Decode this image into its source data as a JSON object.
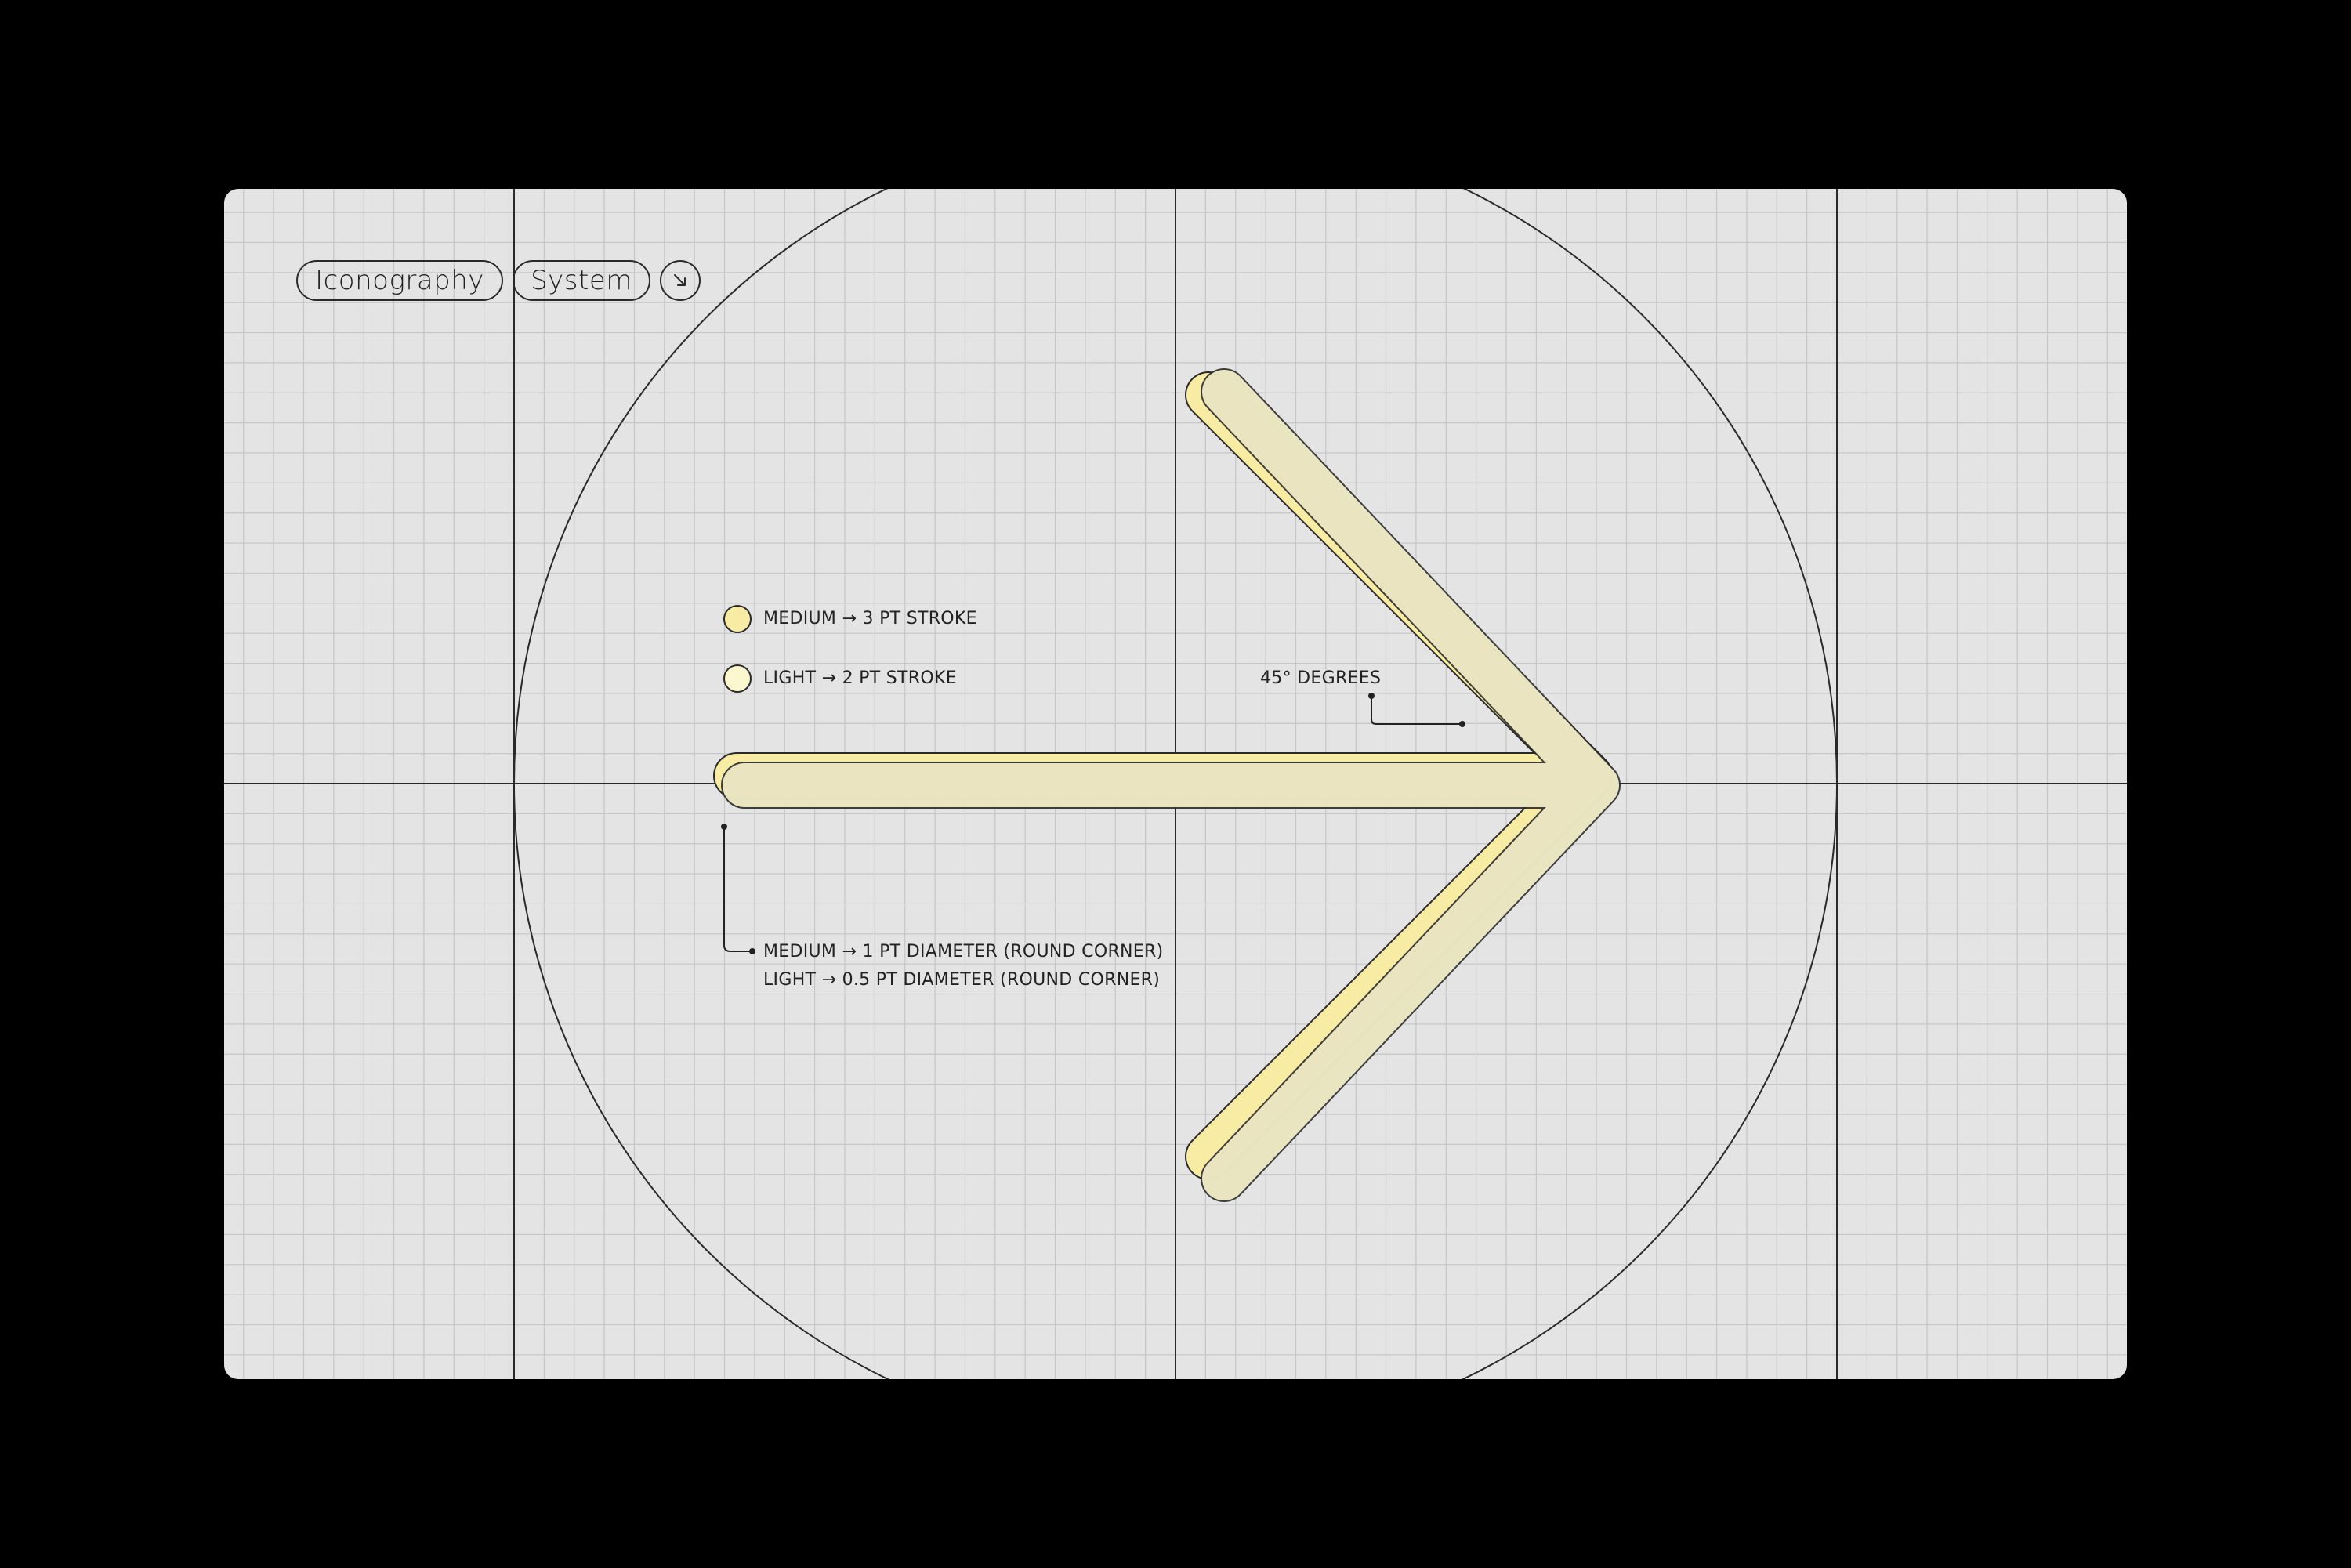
{
  "header": {
    "pill_1": "Iconography",
    "pill_2": "System",
    "arrow_button_icon": "arrow-down-right-icon"
  },
  "legend": {
    "medium_label": "MEDIUM → 3 PT STROKE",
    "light_label": "LIGHT → 2 PT STROKE",
    "medium_color": "#f8eba3",
    "light_color": "#fdf7cf"
  },
  "annotations": {
    "angle": "45° DEGREES",
    "corner_medium": "MEDIUM → 1 PT DIAMETER (ROUND CORNER)",
    "corner_light": "LIGHT → 0.5 PT DIAMETER (ROUND CORNER)"
  },
  "colors": {
    "background": "#000000",
    "panel": "#e4e4e4",
    "grid_line": "#c6c6c6",
    "guide_line": "#2a2a2a",
    "arrow_medium": "#f8eba3",
    "arrow_light": "#fdf7cf"
  }
}
